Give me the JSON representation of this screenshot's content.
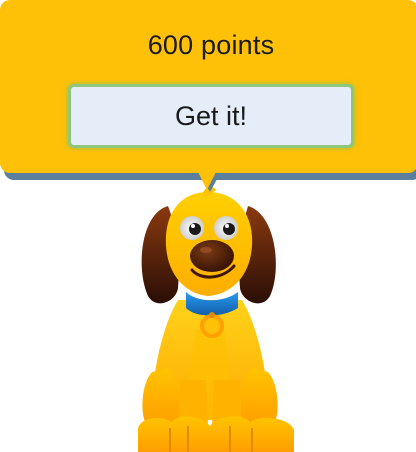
{
  "reward": {
    "points_label": "600 points",
    "button_label": "Get it!"
  },
  "colors": {
    "bubble": "#ffc107",
    "bubble_shadow": "#5b7f9c",
    "button_bg": "#e4edf8",
    "button_border": "#8fc77a",
    "dog_body": "#ffc107",
    "dog_ears": "#6a2a0c",
    "dog_collar": "#1e7fd6"
  },
  "icons": {
    "mascot": "dog-mascot-icon"
  }
}
